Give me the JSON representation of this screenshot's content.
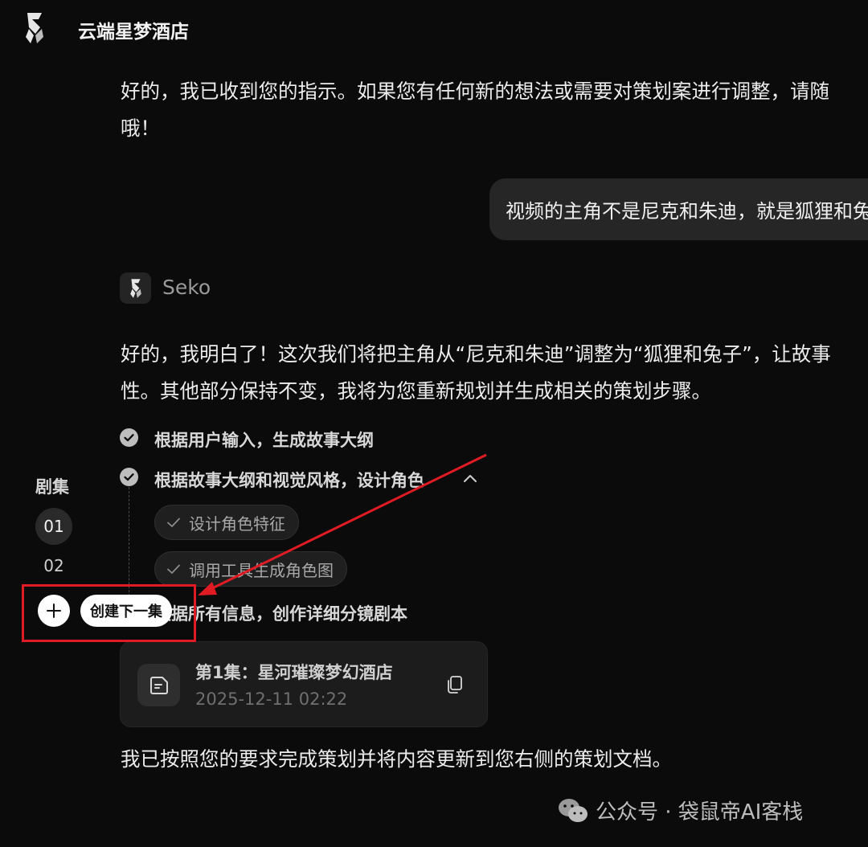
{
  "header": {
    "title": "云端星梦酒店",
    "logo_icon": "brand-s-logo"
  },
  "chat": {
    "assistant_reply_1": {
      "line1": "好的，我已收到您的指示。如果您有任何新的想法或需要对策划案进行调整，请随",
      "line2": "哦！"
    },
    "user_message": "视频的主角不是尼克和朱迪，就是狐狸和兔子",
    "agent": {
      "name": "Seko"
    },
    "assistant_reply_2": {
      "line1": "好的，我明白了！这次我们将把主角从“尼克和朱迪”调整为“狐狸和兔子”，让故事",
      "line2": "性。其他部分保持不变，我将为您重新规划并生成相关的策划步骤。"
    },
    "steps": [
      {
        "label": "根据用户输入，生成故事大纲",
        "status": "done"
      },
      {
        "label": "根据故事大纲和视觉风格，设计角色",
        "status": "done",
        "expanded": true
      },
      {
        "label": "根据所有信息，创作详细分镜剧本",
        "status": "done"
      }
    ],
    "substeps": [
      {
        "label": "设计角色特征"
      },
      {
        "label": "调用工具生成角色图"
      }
    ],
    "document": {
      "title": "第1集：星河璀璨梦幻酒店",
      "date": "2025-12-11 02:22"
    },
    "closing": "我已按照您的要求完成策划并将内容更新到您右侧的策划文档。"
  },
  "episodes": {
    "label": "剧集",
    "items": [
      {
        "label": "01",
        "active": true
      },
      {
        "label": "02",
        "active": false
      }
    ],
    "add_tooltip": "创建下一集"
  },
  "annotation": {
    "color": "#e01b24"
  },
  "watermark": {
    "text": "公众号 · 袋鼠帝AI客栈"
  },
  "colors": {
    "background": "#0b0b0b",
    "bubble": "#262626",
    "chip": "#1f1f1f",
    "card": "#1c1c1c"
  }
}
